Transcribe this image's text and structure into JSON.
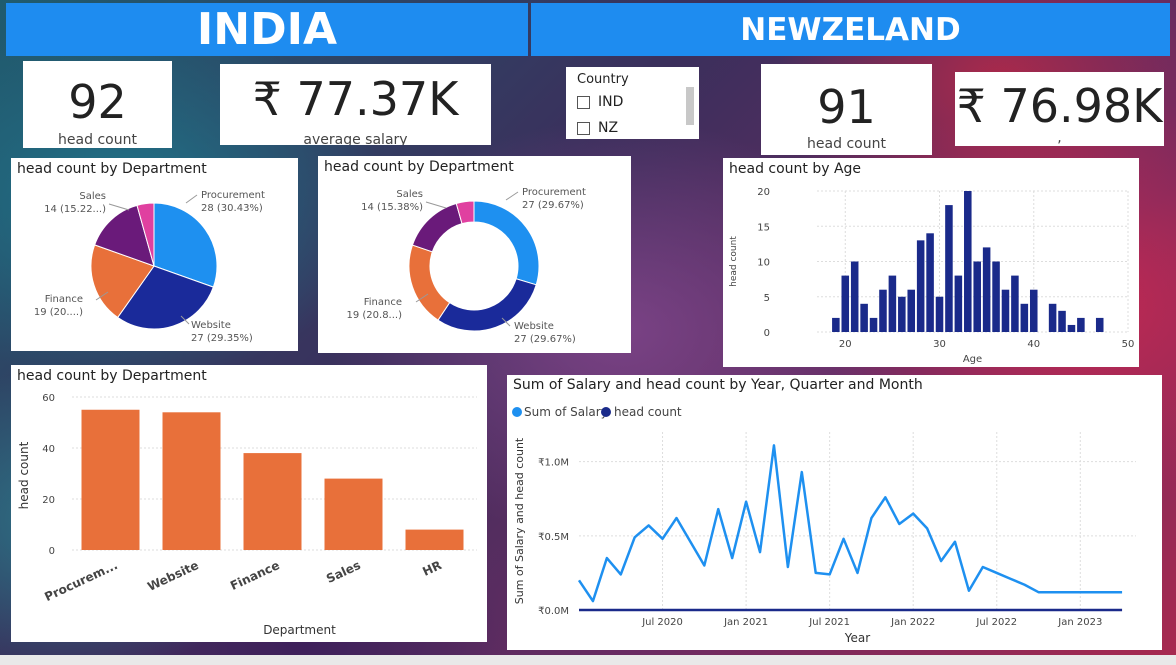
{
  "banners": {
    "left": "INDIA",
    "right": "NEWZELAND"
  },
  "colors": {
    "banner": "#1e8cf0",
    "dept_bar": "#e8703a",
    "age_bar": "#1a2a8a",
    "salary_line": "#1e90f0",
    "headcount_line": "#1a2a8a",
    "pie_procurement": "#1e90f0",
    "pie_website": "#1a2a9a",
    "pie_finance": "#e8703a",
    "pie_sales": "#6a1a7a",
    "pie_hr": "#e040a0"
  },
  "kpis": {
    "india_headcount": {
      "value": "92",
      "label": "head count"
    },
    "india_salary": {
      "value": "₹ 77.37K",
      "label": "average salary"
    },
    "nz_headcount": {
      "value": "91",
      "label": "head count"
    },
    "nz_salary": {
      "value": "₹ 76.98K",
      "label": ","
    }
  },
  "slicer": {
    "title": "Country",
    "options": [
      {
        "label": "IND",
        "checked": false
      },
      {
        "label": "NZ",
        "checked": false
      }
    ]
  },
  "charts": {
    "pie_india": {
      "title": "head count by Department"
    },
    "donut_nz": {
      "title": "head count by Department"
    },
    "age": {
      "title": "head count by Age"
    },
    "dept_bar": {
      "title": "head count by Department"
    },
    "salary_line": {
      "title": "Sum of Salary and head count by Year, Quarter and Month"
    }
  },
  "chart_data": [
    {
      "type": "pie",
      "title": "head count by Department",
      "slices": [
        {
          "name": "Procurement",
          "value": 28,
          "label": "Procurement",
          "sublabel": "28 (30.43%)"
        },
        {
          "name": "Website",
          "value": 27,
          "label": "Website",
          "sublabel": "27 (29.35%)"
        },
        {
          "name": "Finance",
          "value": 19,
          "label": "Finance",
          "sublabel": "19 (20....)"
        },
        {
          "name": "Sales",
          "value": 14,
          "label": "Sales",
          "sublabel": "14 (15.22...)"
        },
        {
          "name": "HR",
          "value": 4,
          "label": "",
          "sublabel": ""
        }
      ]
    },
    {
      "type": "pie",
      "title": "head count by Department",
      "donut": true,
      "slices": [
        {
          "name": "Procurement",
          "value": 27,
          "label": "Procurement",
          "sublabel": "27 (29.67%)"
        },
        {
          "name": "Website",
          "value": 27,
          "label": "Website",
          "sublabel": "27 (29.67%)"
        },
        {
          "name": "Finance",
          "value": 19,
          "label": "Finance",
          "sublabel": "19 (20.8...)"
        },
        {
          "name": "Sales",
          "value": 14,
          "label": "Sales",
          "sublabel": "14 (15.38%)"
        },
        {
          "name": "HR",
          "value": 4,
          "label": "",
          "sublabel": ""
        }
      ]
    },
    {
      "type": "bar",
      "title": "head count by Age",
      "xlabel": "Age",
      "ylabel": "head count",
      "x": [
        19,
        20,
        21,
        22,
        23,
        24,
        25,
        26,
        27,
        28,
        29,
        30,
        31,
        32,
        33,
        34,
        35,
        36,
        37,
        38,
        39,
        40,
        42,
        43,
        44,
        45,
        47
      ],
      "values": [
        2,
        8,
        10,
        4,
        2,
        6,
        8,
        5,
        6,
        13,
        14,
        5,
        18,
        8,
        20,
        10,
        12,
        10,
        6,
        8,
        4,
        6,
        4,
        3,
        1,
        2,
        2
      ],
      "xlim": [
        17,
        50
      ],
      "ylim": [
        0,
        20
      ],
      "xticks": [
        20,
        30,
        40,
        50
      ],
      "yticks": [
        0,
        5,
        10,
        15,
        20
      ],
      "grid": true
    },
    {
      "type": "bar",
      "title": "head count by Department",
      "xlabel": "Department",
      "ylabel": "head count",
      "categories": [
        "Procurem...",
        "Website",
        "Finance",
        "Sales",
        "HR"
      ],
      "values": [
        55,
        54,
        38,
        28,
        8
      ],
      "ylim": [
        0,
        60
      ],
      "yticks": [
        0,
        20,
        40,
        60
      ],
      "grid": true
    },
    {
      "type": "line",
      "title": "Sum of Salary and head count by Year, Quarter and Month",
      "xlabel": "Year",
      "ylabel": "Sum of Salary and head count",
      "legend": "top-left",
      "x_ticks": [
        "Jul 2020",
        "Jan 2021",
        "Jul 2021",
        "Jan 2022",
        "Jul 2022",
        "Jan 2023"
      ],
      "x_tick_months": [
        6,
        12,
        18,
        24,
        30,
        36
      ],
      "y_ticks": [
        "₹0.0M",
        "₹0.5M",
        "₹1.0M"
      ],
      "y_tick_values": [
        0,
        0.5,
        1.0
      ],
      "ylim": [
        0,
        1.2
      ],
      "xlim": [
        0,
        40
      ],
      "series": [
        {
          "name": "Sum of Salary",
          "x": [
            0,
            1,
            2,
            3,
            4,
            5,
            6,
            7,
            8,
            9,
            10,
            11,
            12,
            13,
            14,
            15,
            16,
            17,
            18,
            19,
            20,
            21,
            22,
            23,
            24,
            25,
            26,
            27,
            28,
            29,
            30,
            31,
            32,
            33,
            34,
            37,
            39
          ],
          "values": [
            0.2,
            0.06,
            0.35,
            0.24,
            0.49,
            0.57,
            0.48,
            0.62,
            0.46,
            0.3,
            0.68,
            0.35,
            0.73,
            0.39,
            1.11,
            0.29,
            0.93,
            0.25,
            0.24,
            0.48,
            0.25,
            0.62,
            0.76,
            0.58,
            0.65,
            0.55,
            0.33,
            0.46,
            0.13,
            0.29,
            0.25,
            0.21,
            0.17,
            0.12,
            0.12,
            0.12,
            0.12
          ]
        },
        {
          "name": "head count",
          "x": [
            0,
            39
          ],
          "values": [
            0.0,
            0.0
          ]
        }
      ]
    }
  ]
}
